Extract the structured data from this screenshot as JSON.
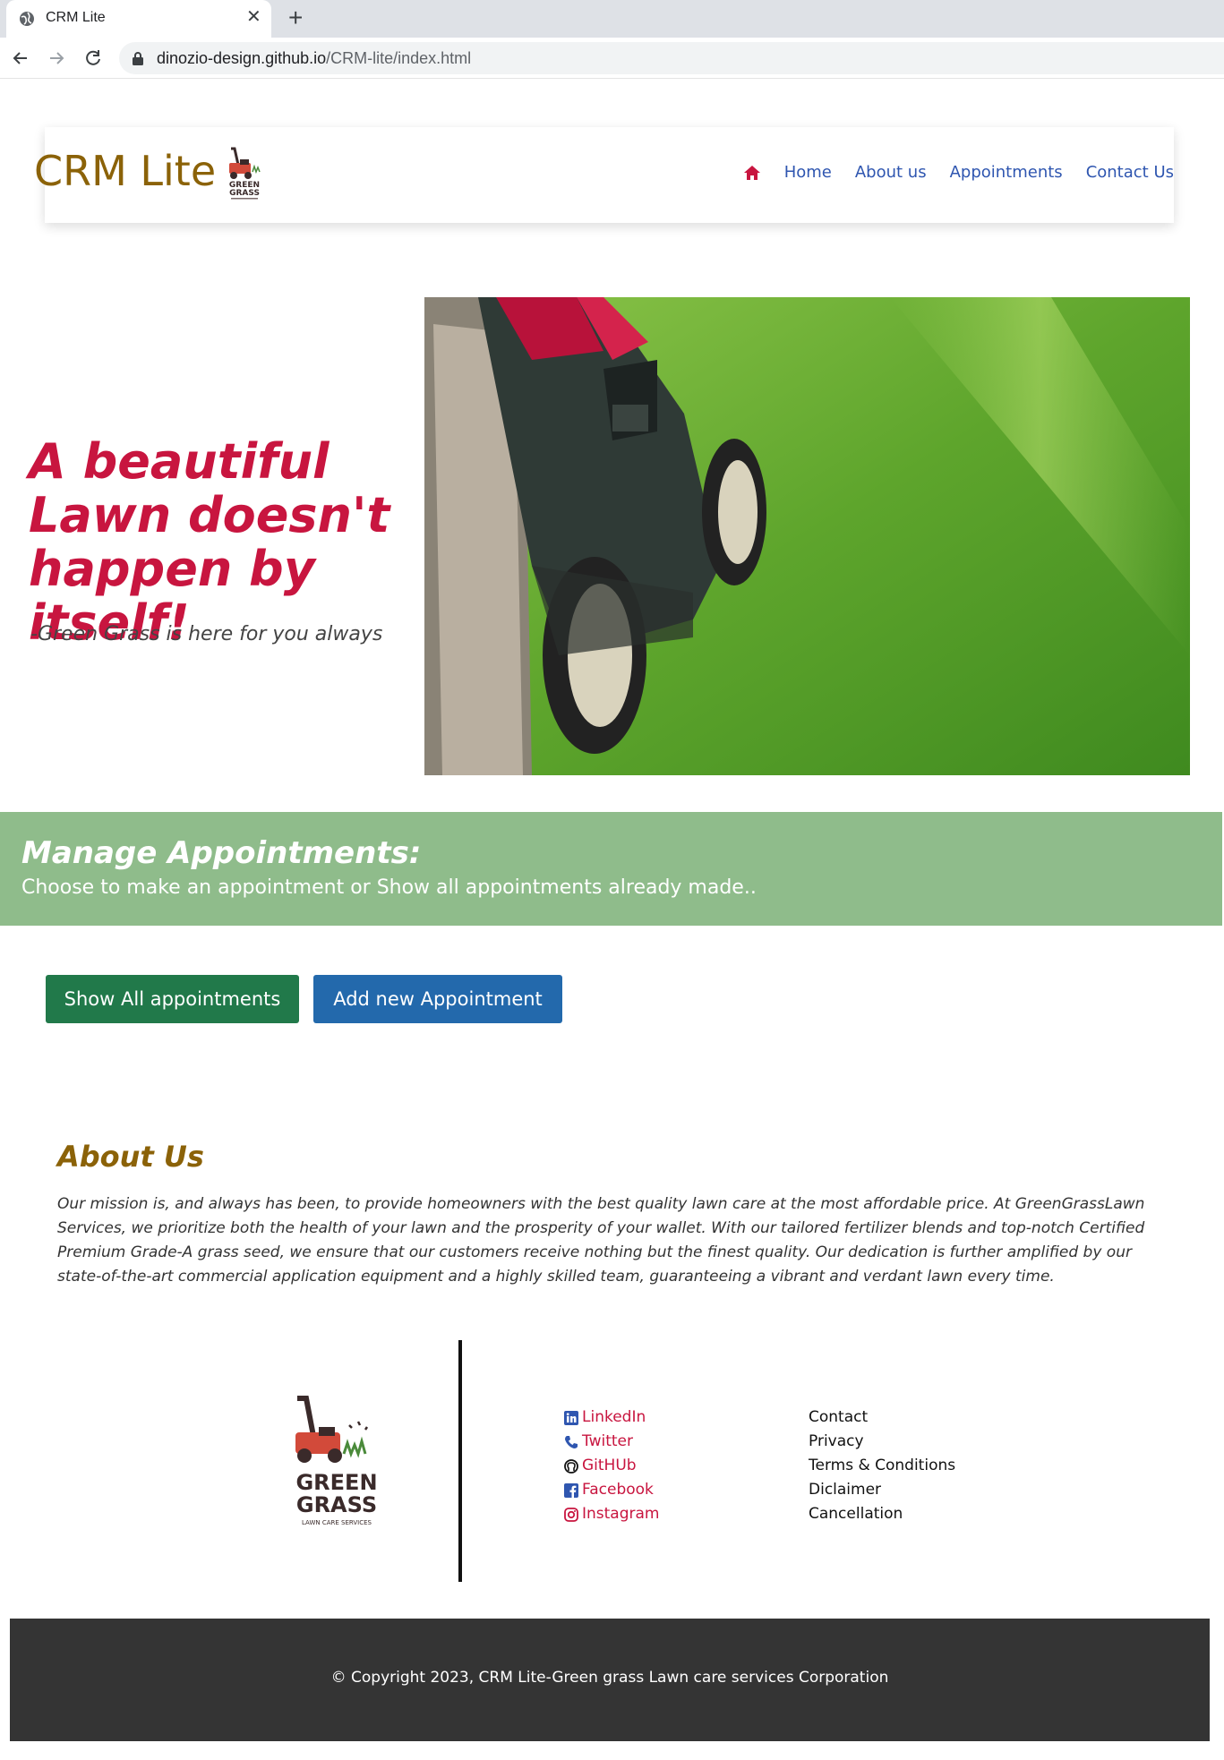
{
  "browser": {
    "tab_title": "CRM Lite",
    "url_host": "dinozio-design.github.io",
    "url_path": "/CRM-lite/index.html"
  },
  "navbar": {
    "brand": "CRM Lite",
    "links": [
      "Home",
      "About us",
      "Appointments",
      "Contact Us"
    ],
    "home_icon_color": "#c8153f"
  },
  "hero": {
    "title": "A beautiful Lawn doesn't happen by itself!",
    "subtitle": "-Green Grass is here for you always"
  },
  "manage": {
    "title": "Manage Appointments:",
    "subtitle": "Choose to make an appointment or Show all appointments already made.."
  },
  "buttons": {
    "show_all": "Show All appointments",
    "add_new": "Add new Appointment"
  },
  "about": {
    "title": "About Us",
    "text": "Our mission is, and always has been, to provide homeowners with the best quality lawn care at the most affordable price. At GreenGrassLawn Services, we prioritize both the health of your lawn and the prosperity of your wallet. With our tailored fertilizer blends and top-notch Certified Premium Grade-A grass seed, we ensure that our customers receive nothing but the finest quality. Our dedication is further amplified by our state-of-the-art commercial application equipment and a highly skilled team, guaranteeing a vibrant and verdant lawn every time."
  },
  "footer": {
    "logo_line1": "GREEN",
    "logo_line2": "GRASS",
    "logo_line3": "LAWN CARE SERVICES",
    "social": [
      "LinkedIn",
      "Twitter",
      "GitHUb",
      "Facebook",
      "Instagram"
    ],
    "links": [
      "Contact",
      "Privacy",
      "Terms & Conditions",
      "Diclaimer",
      "Cancellation"
    ],
    "copyright": "© Copyright 2023, CRM Lite-Green grass Lawn care services Corporation"
  },
  "colors": {
    "brand": "#8b6208",
    "accent_red": "#c8153f",
    "link_blue": "#2f56b0",
    "banner_green": "#8fbc8b",
    "btn_green": "#21794a",
    "btn_blue": "#2369ac",
    "footer_dark": "#343434"
  }
}
